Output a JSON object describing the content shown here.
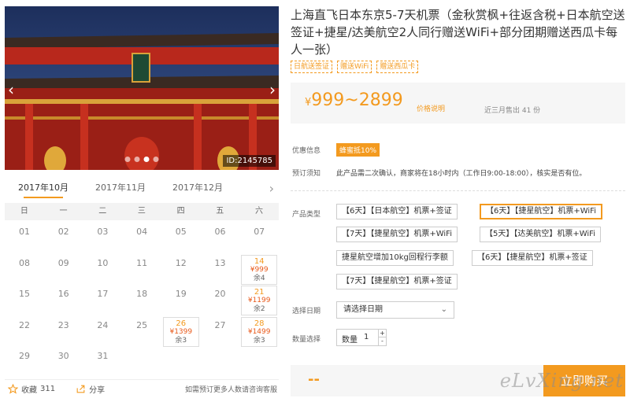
{
  "gallery": {
    "photo_id": "ID:2145785",
    "prev_arrow": "‹",
    "next_arrow": "›"
  },
  "calendar": {
    "months": [
      "2017年10月",
      "2017年11月",
      "2017年12月"
    ],
    "active_month": 0,
    "next_arrow": "›",
    "weekdays": [
      "日",
      "一",
      "二",
      "三",
      "四",
      "五",
      "六"
    ],
    "days": [
      {
        "d": "01"
      },
      {
        "d": "02"
      },
      {
        "d": "03"
      },
      {
        "d": "04"
      },
      {
        "d": "05"
      },
      {
        "d": "06"
      },
      {
        "d": "07"
      },
      {
        "d": "08"
      },
      {
        "d": "09"
      },
      {
        "d": "10"
      },
      {
        "d": "11"
      },
      {
        "d": "12"
      },
      {
        "d": "13"
      },
      {
        "d": "14",
        "price": "¥999",
        "rem": "余4"
      },
      {
        "d": "15"
      },
      {
        "d": "16"
      },
      {
        "d": "17"
      },
      {
        "d": "18"
      },
      {
        "d": "19"
      },
      {
        "d": "20"
      },
      {
        "d": "21",
        "price": "¥1199",
        "rem": "余2"
      },
      {
        "d": "22"
      },
      {
        "d": "23"
      },
      {
        "d": "24"
      },
      {
        "d": "25"
      },
      {
        "d": "26",
        "price": "¥1399",
        "rem": "余3"
      },
      {
        "d": "27"
      },
      {
        "d": "28",
        "price": "¥1499",
        "rem": "余3"
      },
      {
        "d": "29"
      },
      {
        "d": "30"
      },
      {
        "d": "31"
      }
    ]
  },
  "footer": {
    "favorite_label": "收藏",
    "favorite_count": "311",
    "share_label": "分享",
    "consult_text": "如需预订更多人数请咨询客服"
  },
  "product": {
    "title": "上海直飞日本东京5-7天机票（金秋赏枫+往返含税+日本航空送签证+捷星/达美航空2人同行赠送WiFi+部分团期赠送西瓜卡每人一张）",
    "tags": [
      "日航送签证",
      "赠送WiFi",
      "赠送西瓜卡"
    ],
    "price_yen": "¥",
    "price_range": "999~2899",
    "price_note": "价格说明",
    "sold_text": "近三月售出 41 份"
  },
  "info": {
    "promo_label": "优惠信息",
    "promo_badge": "蜂蜜抵10%",
    "notice_label": "预订须知",
    "notice_text": "此产品需二次确认，商家将在18小时内（工作日9:00-18:00），核实是否有位。"
  },
  "options": {
    "type_label": "产品类型",
    "items": [
      "【6天】【日本航空】机票+签证",
      "【6天】【捷星航空】机票+WiFi",
      "【7天】【捷星航空】机票+WiFi",
      "【5天】【达美航空】机票+WiFi",
      "捷星航空增加10kg回程行李额",
      "【6天】【捷星航空】机票+签证",
      "【7天】【捷星航空】机票+签证"
    ],
    "selected_index": 1
  },
  "booking": {
    "date_label": "选择日期",
    "date_placeholder": "请选择日期",
    "qty_label": "数量选择",
    "qty_field_label": "数量",
    "qty_value": "1",
    "total": "--",
    "buy_label": "立即购买"
  },
  "watermark": "eLvXing.net",
  "colors": {
    "accent": "#f39a1f",
    "price": "#e8591a"
  }
}
